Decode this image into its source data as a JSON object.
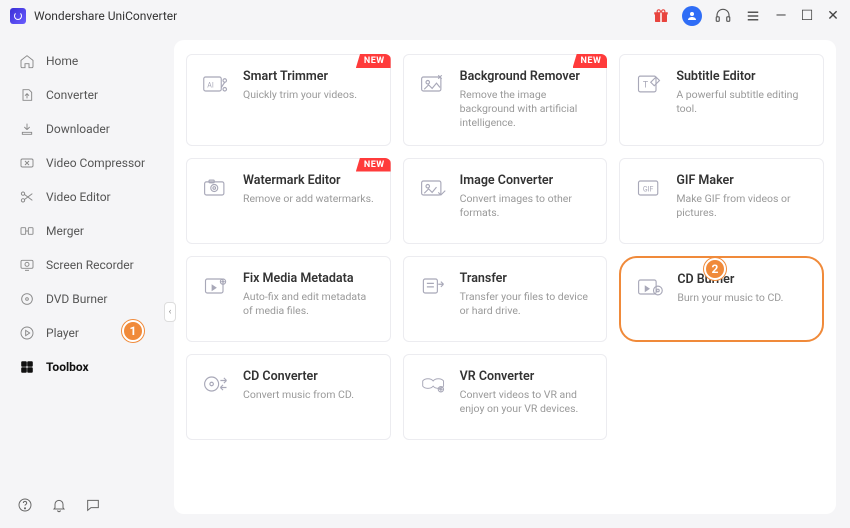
{
  "app_title": "Wondershare UniConverter",
  "sidebar": {
    "items": [
      {
        "label": "Home"
      },
      {
        "label": "Converter"
      },
      {
        "label": "Downloader"
      },
      {
        "label": "Video Compressor"
      },
      {
        "label": "Video Editor"
      },
      {
        "label": "Merger"
      },
      {
        "label": "Screen Recorder"
      },
      {
        "label": "DVD Burner"
      },
      {
        "label": "Player"
      },
      {
        "label": "Toolbox"
      }
    ],
    "active_index": 9
  },
  "callouts": {
    "one": "1",
    "two": "2"
  },
  "badges": {
    "new": "NEW"
  },
  "tools": [
    {
      "title": "Smart Trimmer",
      "desc": "Quickly trim your videos.",
      "new": true
    },
    {
      "title": "Background Remover",
      "desc": "Remove the image background with artificial intelligence.",
      "new": true
    },
    {
      "title": "Subtitle Editor",
      "desc": "A powerful subtitle editing tool."
    },
    {
      "title": "Watermark Editor",
      "desc": "Remove or add watermarks.",
      "new": true
    },
    {
      "title": "Image Converter",
      "desc": "Convert images to other formats."
    },
    {
      "title": "GIF Maker",
      "desc": "Make GIF from videos or pictures."
    },
    {
      "title": "Fix Media Metadata",
      "desc": "Auto-fix and edit metadata of media files."
    },
    {
      "title": "Transfer",
      "desc": "Transfer your files to device or hard drive."
    },
    {
      "title": "CD Burner",
      "desc": "Burn your music to CD.",
      "highlight": true
    },
    {
      "title": "CD Converter",
      "desc": "Convert music from CD."
    },
    {
      "title": "VR Converter",
      "desc": "Convert videos to VR and enjoy on your VR devices."
    }
  ]
}
